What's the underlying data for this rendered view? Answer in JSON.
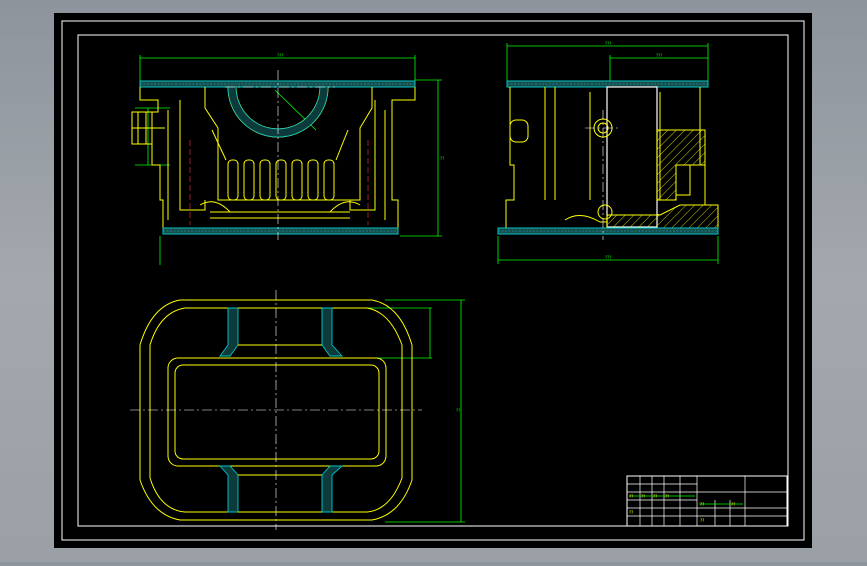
{
  "drawing": {
    "views": [
      "front-view",
      "side-view",
      "top-view"
    ],
    "colors": {
      "background": "#8e949c",
      "canvas": "#000000",
      "border": "#ffffff",
      "outline": "#ffff00",
      "dimension": "#00ff00",
      "centerline": "#ffffff",
      "hatch": "#00c8c8",
      "title_block": "#ffffff"
    },
    "dimension_labels": {
      "front_width": "???",
      "front_height": "??",
      "side_width": "???",
      "side_inner": "???",
      "side_bottom": "???",
      "top_height": "??"
    },
    "title_block": {
      "cells": [
        "??",
        "??",
        "??",
        "??",
        "??",
        "??",
        "??",
        "??"
      ]
    }
  }
}
